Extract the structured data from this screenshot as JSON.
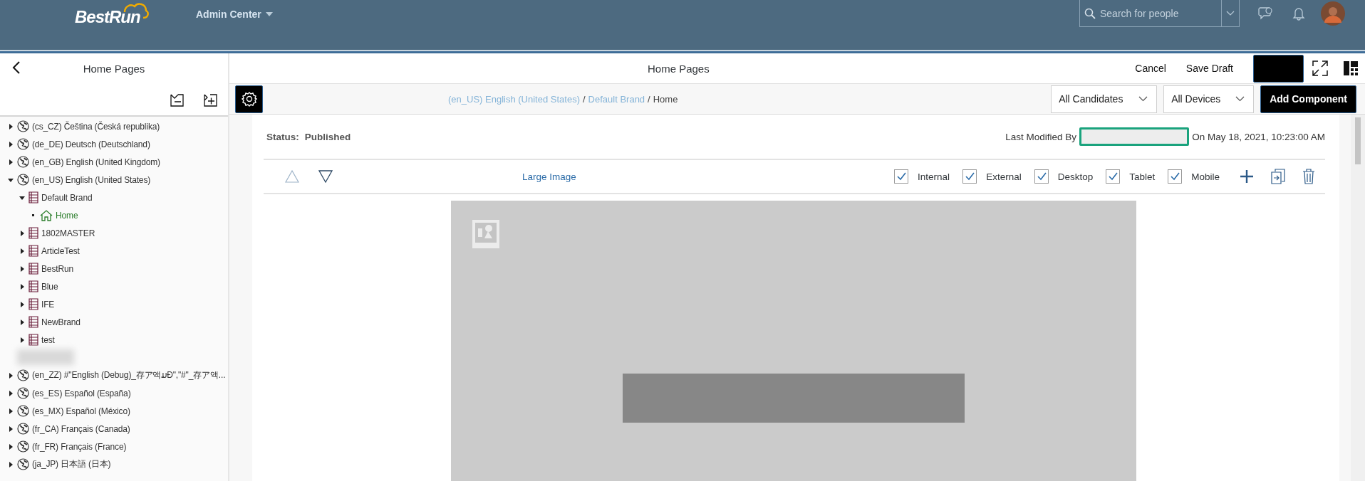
{
  "header": {
    "logo": "BestRun",
    "app_menu": "Admin Center",
    "search": {
      "placeholder": "Search for people"
    }
  },
  "left_panel": {
    "title": "Home Pages",
    "tree": [
      {
        "kind": "language",
        "label": "(cs_CZ) Čeština (Česká republika)",
        "expanded": false,
        "selected": false
      },
      {
        "kind": "language",
        "label": "(de_DE) Deutsch (Deutschland)",
        "expanded": false,
        "selected": false
      },
      {
        "kind": "language",
        "label": "(en_GB) English (United Kingdom)",
        "expanded": false,
        "selected": false
      },
      {
        "kind": "language",
        "label": "(en_US) English (United States)",
        "expanded": true,
        "selected": false,
        "children": [
          {
            "kind": "brand",
            "label": "Default Brand",
            "expanded": true,
            "selected": false,
            "children": [
              {
                "kind": "page",
                "label": "Home",
                "selected": true
              }
            ]
          },
          {
            "kind": "brand",
            "label": "1802MASTER",
            "expanded": false,
            "selected": false
          },
          {
            "kind": "brand",
            "label": "ArticleTest",
            "expanded": false,
            "selected": false
          },
          {
            "kind": "brand",
            "label": "BestRun",
            "expanded": false,
            "selected": false
          },
          {
            "kind": "brand",
            "label": "Blue",
            "expanded": false,
            "selected": false
          },
          {
            "kind": "brand",
            "label": "IFE",
            "expanded": false,
            "selected": false
          },
          {
            "kind": "brand",
            "label": "NewBrand",
            "expanded": false,
            "selected": false
          },
          {
            "kind": "brand",
            "label": "test",
            "expanded": false,
            "selected": false
          }
        ]
      },
      {
        "kind": "redacted"
      },
      {
        "kind": "language",
        "label": "(en_ZZ) #\"English (Debug)_存ア액ມĐ\",\"#\"_存ア액...",
        "expanded": false,
        "selected": false
      },
      {
        "kind": "language",
        "label": "(es_ES) Español (España)",
        "expanded": false,
        "selected": false
      },
      {
        "kind": "language",
        "label": "(es_MX) Español (México)",
        "expanded": false,
        "selected": false
      },
      {
        "kind": "language",
        "label": "(fr_CA) Français (Canada)",
        "expanded": false,
        "selected": false
      },
      {
        "kind": "language",
        "label": "(fr_FR) Français (France)",
        "expanded": false,
        "selected": false
      },
      {
        "kind": "language",
        "label": "(ja_JP) 日本語 (日本)",
        "expanded": false,
        "selected": false
      }
    ]
  },
  "main": {
    "title": "Home Pages",
    "actions": [
      "Cancel",
      "Save Draft"
    ],
    "breadcrumb": [
      {
        "label": "(en_US) English (United States)",
        "kind": "link"
      },
      {
        "label": "/",
        "kind": "separator"
      },
      {
        "label": "Default Brand",
        "kind": "link"
      },
      {
        "label": "/",
        "kind": "separator"
      },
      {
        "label": "Home",
        "kind": "current"
      }
    ],
    "filters": [
      "All Candidates",
      "All Devices"
    ],
    "add_button": "Add Component",
    "status_label": "Status:",
    "status": "Published",
    "last_modified_label": "Last Modified By",
    "last_modified_on": "On May 18, 2021, 10:23:00 AM",
    "component": {
      "name": "Large Image",
      "visibility": [
        {
          "label": "Internal",
          "checked": true
        },
        {
          "label": "External",
          "checked": true
        },
        {
          "label": "Desktop",
          "checked": true
        },
        {
          "label": "Tablet",
          "checked": true
        },
        {
          "label": "Mobile",
          "checked": true
        }
      ]
    }
  }
}
